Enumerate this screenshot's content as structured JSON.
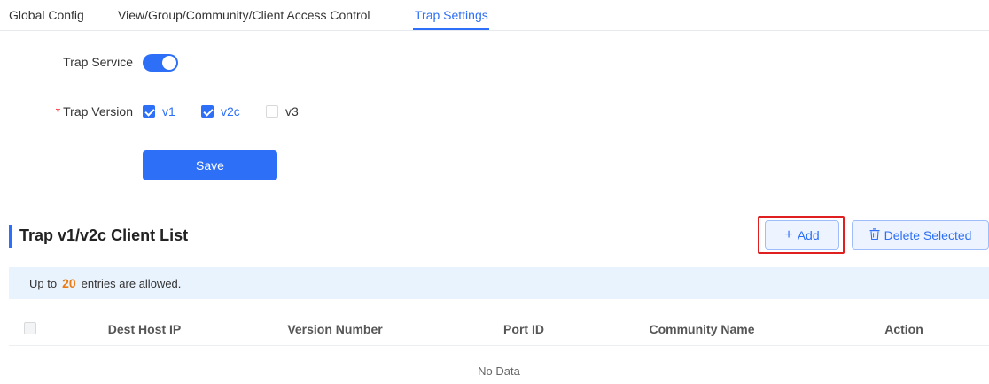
{
  "tabs": [
    {
      "label": "Global Config",
      "active": false
    },
    {
      "label": "View/Group/Community/Client Access Control",
      "active": false
    },
    {
      "label": "Trap Settings",
      "active": true
    }
  ],
  "form": {
    "trap_service_label": "Trap Service",
    "trap_service_enabled": true,
    "required_mark": "*",
    "trap_version_label": "Trap Version",
    "versions": [
      {
        "label": "v1",
        "checked": true
      },
      {
        "label": "v2c",
        "checked": true
      },
      {
        "label": "v3",
        "checked": false
      }
    ],
    "save_label": "Save"
  },
  "client_list": {
    "title": "Trap v1/v2c Client List",
    "add_label": "Add",
    "delete_label": "Delete Selected",
    "banner_prefix": "Up to",
    "banner_count": "20",
    "banner_suffix": "entries are allowed.",
    "columns": [
      "Dest Host IP",
      "Version Number",
      "Port ID",
      "Community Name",
      "Action"
    ],
    "rows": [],
    "empty_text": "No Data"
  },
  "colors": {
    "accent": "#2d6ff6",
    "highlight": "#e02020",
    "count": "#ea7a14",
    "banner_bg": "#e9f3fd"
  },
  "icons": {
    "add": "plus-icon",
    "delete": "trash-icon"
  }
}
